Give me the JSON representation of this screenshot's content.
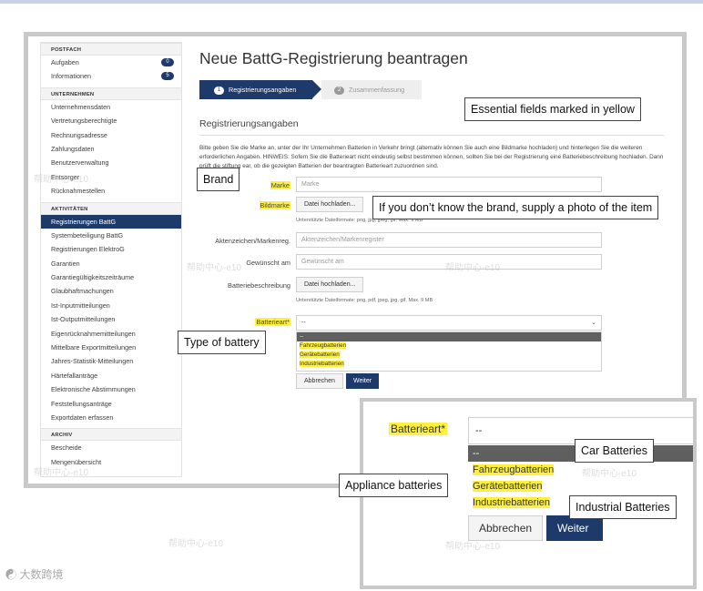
{
  "sidebar": {
    "sections": [
      {
        "heading": "POSTFACH",
        "items": [
          {
            "label": "Aufgaben",
            "badge": "0"
          },
          {
            "label": "Informationen",
            "badge": "5"
          }
        ]
      },
      {
        "heading": "UNTERNEHMEN",
        "items": [
          {
            "label": "Unternehmensdaten"
          },
          {
            "label": "Vertretungsberechtigte"
          },
          {
            "label": "Rechnungsadresse"
          },
          {
            "label": "Zahlungsdaten"
          },
          {
            "label": "Benutzerverwaltung"
          },
          {
            "label": "Entsorger"
          },
          {
            "label": "Rücknahmestellen"
          }
        ]
      },
      {
        "heading": "AKTIVITÄTEN",
        "items": [
          {
            "label": "Registrierungen BattG",
            "active": true
          },
          {
            "label": "Systembeteiligung BattG"
          },
          {
            "label": "Registrierungen ElektroG"
          },
          {
            "label": "Garantien"
          },
          {
            "label": "Garantiegültigkeitszeiträume"
          },
          {
            "label": "Glaubhaftmachungen"
          },
          {
            "label": "Ist-Inputmitteilungen"
          },
          {
            "label": "Ist-Outputmitteilungen"
          },
          {
            "label": "Eigenrücknahmemitteilungen"
          },
          {
            "label": "Mittelbare Exportmitteilungen"
          },
          {
            "label": "Jahres-Statistik-Mitteilungen"
          },
          {
            "label": "Härtefallanträge"
          },
          {
            "label": "Elektronische Abstimmungen"
          },
          {
            "label": "Feststellungsanträge"
          },
          {
            "label": "Exportdaten erfassen"
          }
        ]
      },
      {
        "heading": "ARCHIV",
        "items": [
          {
            "label": "Bescheide"
          },
          {
            "label": "Mengenübersicht"
          }
        ]
      }
    ]
  },
  "page": {
    "title": "Neue BattG-Registrierung beantragen",
    "steps": [
      {
        "num": "1",
        "label": "Registrierungsangaben"
      },
      {
        "num": "2",
        "label": "Zusammenfassung"
      }
    ],
    "section_title": "Registrierungsangaben",
    "intro": "Bitte geben Sie die Marke an, unter der Ihr Unternehmen Batterien in Verkehr bringt (alternativ können Sie auch eine Bildmarke hochladen) und hinterlegen Sie die weiteren erforderlichen Angaben. HINWEIS: Sofern Sie die Batterieart nicht eindeutig selbst bestimmen können, sollten Sie bei der Registrierung eine Batteriebeschreibung hochladen. Dann prüft die stiftung ear, ob die gezeigten Batterien der beantragten Batterieart zuzuordnen sind."
  },
  "form": {
    "marke_label": "Marke",
    "marke_placeholder": "Marke",
    "bildmarke_label": "Bildmarke",
    "upload_label": "Datei hochladen...",
    "bildmarke_hint": "Unterstützte Dateiformate: png, jpg, jpeg, gif. Max. 9 MB",
    "aktenzeichen_label": "Aktenzeichen/Markenreg.",
    "aktenzeichen_placeholder": "Aktenzeichen/Markenregister",
    "gewuenscht_label": "Gewünscht am",
    "gewuenscht_placeholder": "Gewünscht am",
    "beschreibung_label": "Batteriebeschreibung",
    "beschreibung_upload": "Datei hochladen...",
    "beschreibung_hint": "Unterstützte Dateiformate: png, pdf, jpeg, jpg, gif. Max. 9 MB",
    "batterieart_label": "Batterieart*",
    "batterieart_value": "--",
    "batterieart_options": [
      "--",
      "Fahrzeugbatterien",
      "Gerätebatterien",
      "Industriebatterien"
    ],
    "cancel_label": "Abbrechen",
    "next_label": "Weiter"
  },
  "callouts": {
    "essential": "Essential fields marked in yellow",
    "brand": "Brand",
    "photo": "If you don’t know the brand, supply a photo of the item",
    "type": "Type of battery",
    "car": "Car Batteries",
    "appliance": "Appliance batteries",
    "industrial": "Industrial Batteries"
  },
  "watermark": "帮助中心-e10",
  "footer_logo": "大数跨境"
}
